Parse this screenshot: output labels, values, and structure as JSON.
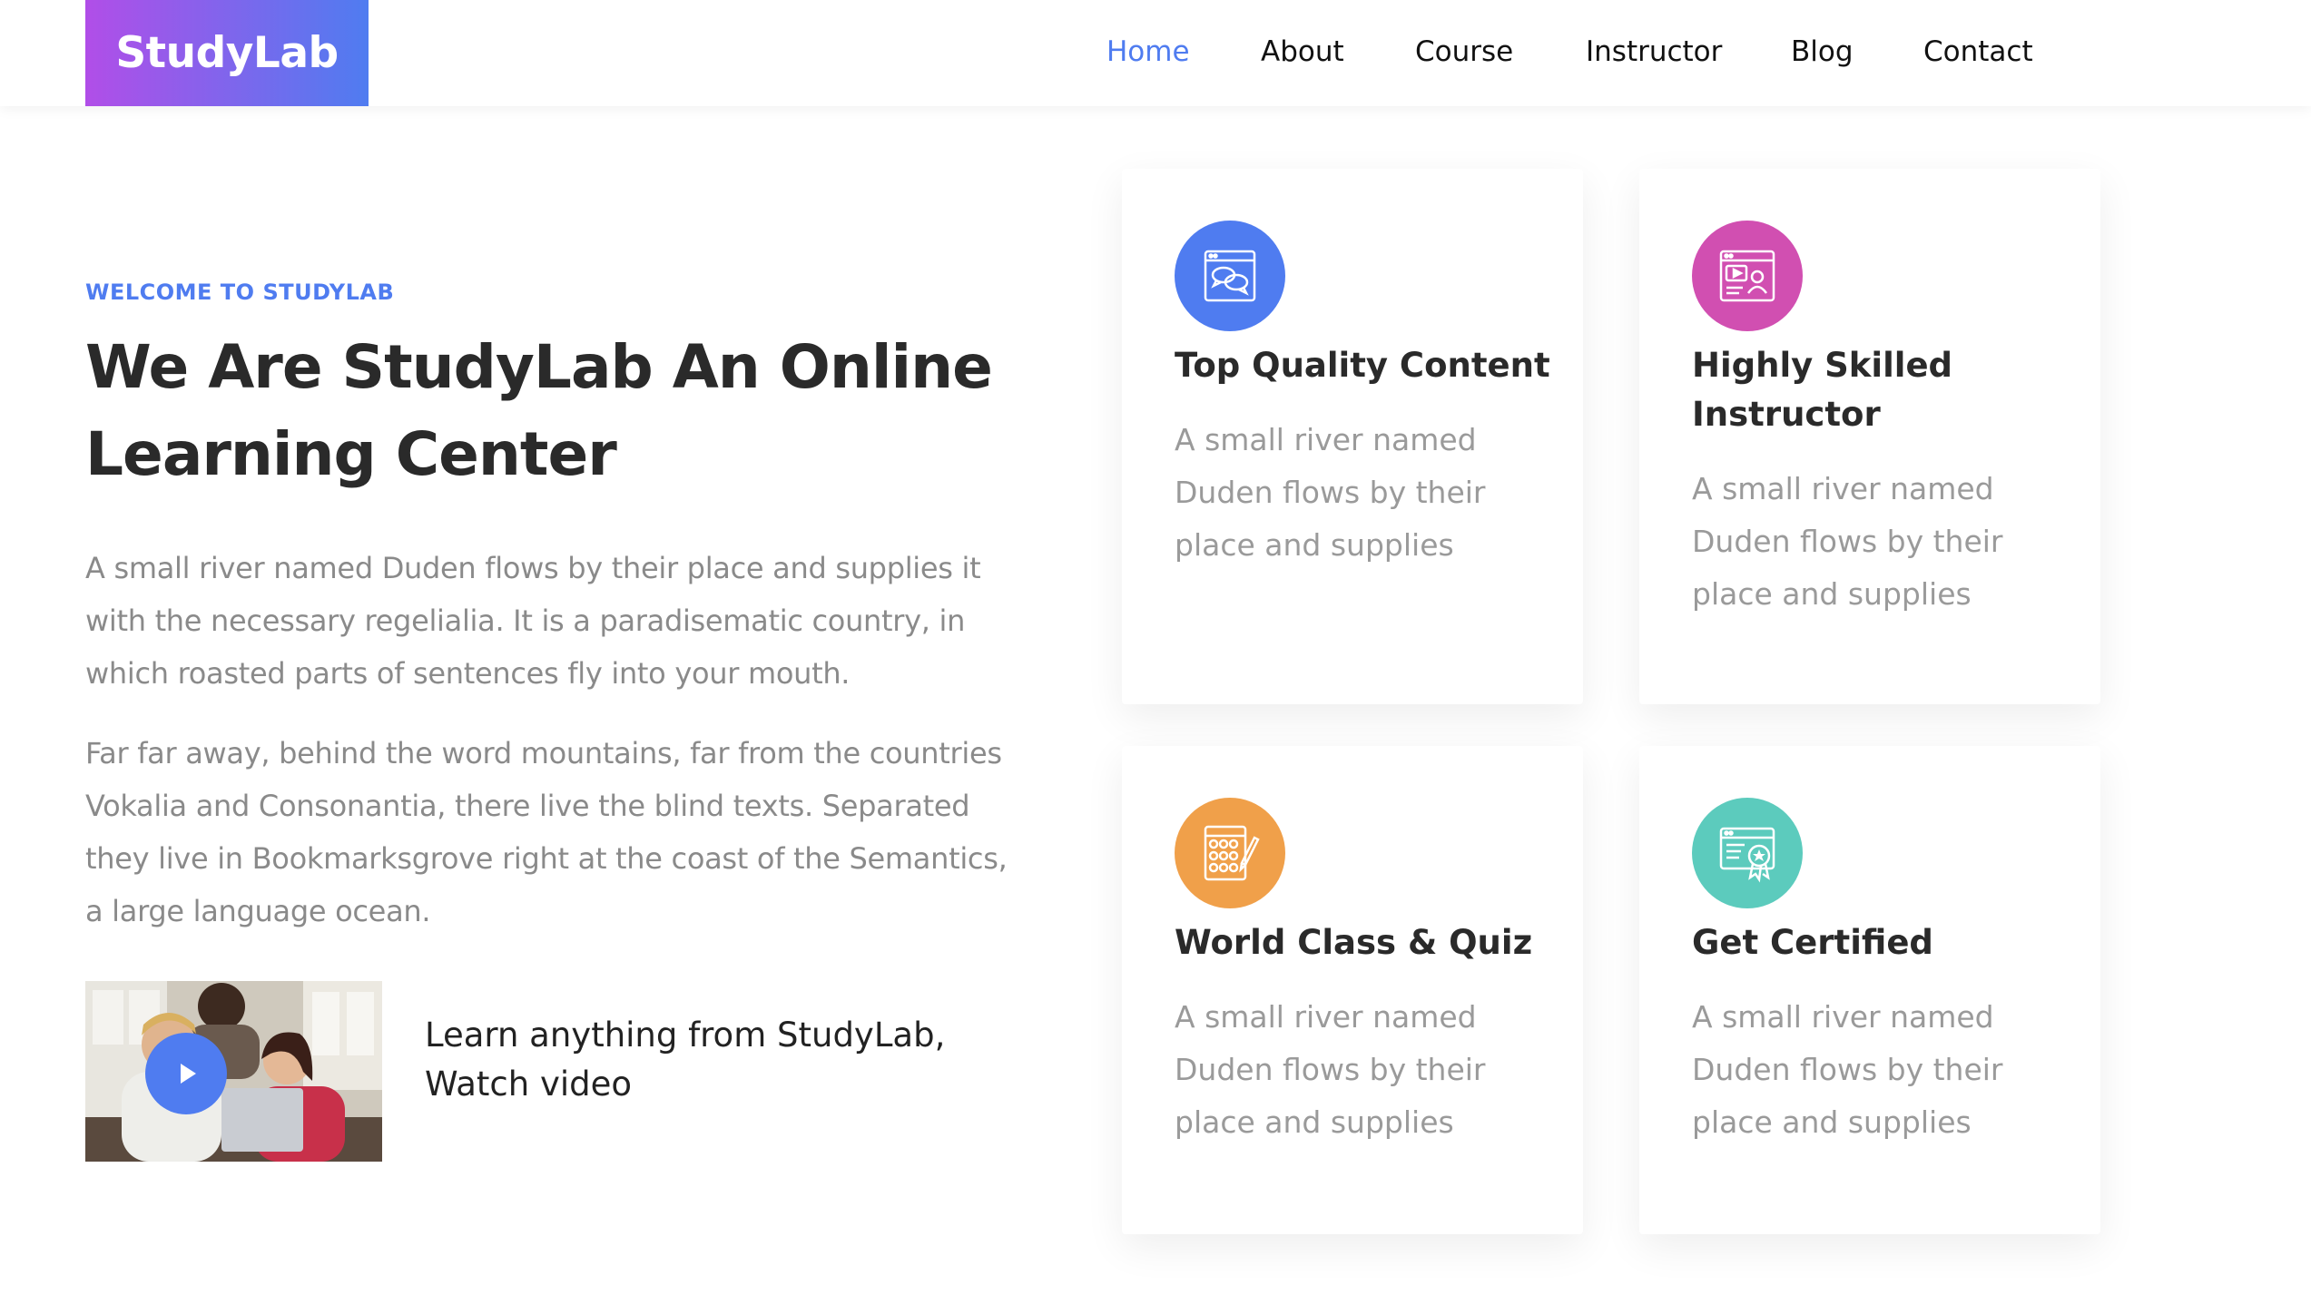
{
  "header": {
    "logo": "StudyLab",
    "nav": [
      "Home",
      "About",
      "Course",
      "Instructor",
      "Blog",
      "Contact"
    ],
    "active": "Home"
  },
  "hero": {
    "eyebrow": "WELCOME TO STUDYLAB",
    "title_line1": "We Are StudyLab An Online",
    "title_line2": "Learning Center",
    "paragraph1": "A small river named Duden flows by their place and supplies it with the necessary regelialia. It is a paradisematic country, in which roasted parts of sentences fly into your mouth.",
    "paragraph2": "Far far away, behind the word mountains, far from the countries Vokalia and Consonantia, there live the blind texts. Separated they live in Bookmarksgrove right at the coast of the Semantics, a large language ocean.",
    "video_line1": "Learn anything from StudyLab,",
    "video_line2": "Watch video"
  },
  "features": [
    {
      "title": "Top Quality Content",
      "description": "A small river named Duden flows by their place and supplies",
      "icon": "chat-window-icon",
      "color": "#4f7cf0"
    },
    {
      "title": "Highly Skilled Instructor",
      "description": "A small river named Duden flows by their place and supplies",
      "icon": "video-instructor-icon",
      "color": "#d14fb1"
    },
    {
      "title": "World Class & Quiz",
      "description": "A small river named Duden flows by their place and supplies",
      "icon": "quiz-sheet-icon",
      "color": "#f0a04a"
    },
    {
      "title": "Get Certified",
      "description": "A small river named Duden flows by their place and supplies",
      "icon": "certificate-icon",
      "color": "#5ccbbd"
    }
  ]
}
